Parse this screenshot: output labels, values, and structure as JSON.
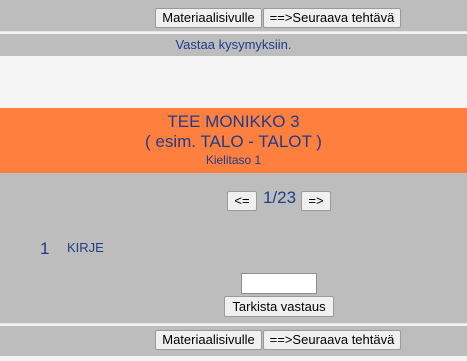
{
  "top_nav": {
    "material_button": "Materiaalisivulle",
    "next_task_button": "==>Seuraava tehtävä"
  },
  "instruction": "Vastaa kysymyksiin.",
  "header": {
    "title": "TEE MONIKKO 3",
    "subtitle": "( esim. TALO - TALOT )",
    "level": "Kielitaso 1"
  },
  "pager": {
    "prev_label": "<=",
    "position": "1/23",
    "next_label": "=>"
  },
  "question": {
    "number": "1",
    "word": "KIRJE"
  },
  "answer": {
    "value": "",
    "check_button": "Tarkista vastaus"
  },
  "bottom_nav": {
    "material_button": "Materiaalisivulle",
    "next_task_button": "==>Seuraava tehtävä"
  },
  "colors": {
    "header_background": "#ff7f3f",
    "panel_gray": "#bdbdbd",
    "text_blue": "#1f3d8c"
  }
}
